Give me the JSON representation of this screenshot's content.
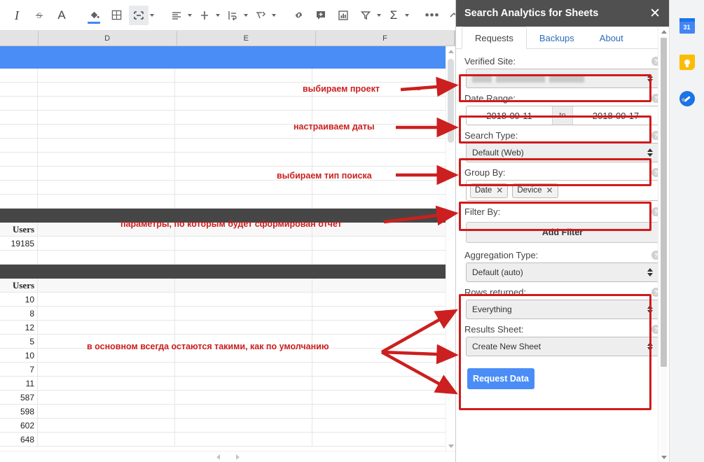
{
  "toolbar": {
    "items": [
      {
        "name": "italic-icon",
        "glyph": "I"
      },
      {
        "name": "strikethrough-icon",
        "glyph": "S"
      },
      {
        "name": "text-color-icon",
        "glyph": "A"
      },
      {
        "name": "fill-color-icon",
        "glyph": "fill"
      },
      {
        "name": "borders-icon",
        "glyph": "grid"
      },
      {
        "name": "merge-cells-icon",
        "glyph": "merge"
      },
      {
        "name": "horizontal-align-icon",
        "glyph": "align"
      },
      {
        "name": "vertical-align-icon",
        "glyph": "valign"
      },
      {
        "name": "text-wrapping-icon",
        "glyph": "wrap"
      },
      {
        "name": "text-rotation-icon",
        "glyph": "rotate"
      },
      {
        "name": "insert-link-icon",
        "glyph": "link"
      },
      {
        "name": "insert-comment-icon",
        "glyph": "comment"
      },
      {
        "name": "insert-chart-icon",
        "glyph": "chart"
      },
      {
        "name": "create-filter-icon",
        "glyph": "filter"
      },
      {
        "name": "functions-icon",
        "glyph": "sigma"
      },
      {
        "name": "more-options-icon",
        "glyph": "dots"
      },
      {
        "name": "collapse-toolbar-icon",
        "glyph": "chevron-up"
      }
    ],
    "more_dots": "•••",
    "italic_label": "I",
    "strike_label": "S",
    "textcolor_label": "A",
    "sigma_label": "Σ"
  },
  "sheet": {
    "columns": [
      "",
      "D",
      "E",
      "F"
    ],
    "rows": [
      {
        "type": "selected",
        "values": [
          "",
          "",
          "",
          ""
        ]
      },
      {
        "type": "blank",
        "values": [
          "",
          "",
          "",
          ""
        ]
      },
      {
        "type": "blank",
        "values": [
          "",
          "",
          "",
          ""
        ]
      },
      {
        "type": "blank",
        "values": [
          "",
          "",
          "",
          ""
        ]
      },
      {
        "type": "blank",
        "values": [
          "",
          "",
          "",
          ""
        ]
      },
      {
        "type": "blank",
        "values": [
          "",
          "",
          "",
          ""
        ]
      },
      {
        "type": "blank",
        "values": [
          "",
          "",
          "",
          ""
        ]
      },
      {
        "type": "blank",
        "values": [
          "",
          "",
          "",
          ""
        ]
      },
      {
        "type": "blank",
        "values": [
          "",
          "",
          "",
          ""
        ]
      },
      {
        "type": "blank",
        "values": [
          "",
          "",
          "",
          ""
        ]
      },
      {
        "type": "blank",
        "values": [
          "",
          "",
          "",
          ""
        ]
      },
      {
        "type": "dark",
        "values": [
          "",
          "",
          "",
          ""
        ]
      },
      {
        "type": "header",
        "values": [
          "Users",
          "",
          "",
          ""
        ]
      },
      {
        "type": "data",
        "values": [
          "19185",
          "",
          "",
          ""
        ]
      },
      {
        "type": "blank",
        "values": [
          "",
          "",
          "",
          ""
        ]
      },
      {
        "type": "dark",
        "values": [
          "",
          "",
          "",
          ""
        ]
      },
      {
        "type": "header",
        "values": [
          "Users",
          "",
          "",
          ""
        ]
      },
      {
        "type": "data",
        "values": [
          "10",
          "",
          "",
          ""
        ]
      },
      {
        "type": "data",
        "values": [
          "8",
          "",
          "",
          ""
        ]
      },
      {
        "type": "data",
        "values": [
          "12",
          "",
          "",
          ""
        ]
      },
      {
        "type": "data",
        "values": [
          "5",
          "",
          "",
          ""
        ]
      },
      {
        "type": "data",
        "values": [
          "10",
          "",
          "",
          ""
        ]
      },
      {
        "type": "data",
        "values": [
          "7",
          "",
          "",
          ""
        ]
      },
      {
        "type": "data",
        "values": [
          "11",
          "",
          "",
          ""
        ]
      },
      {
        "type": "data",
        "values": [
          "587",
          "",
          "",
          ""
        ]
      },
      {
        "type": "data",
        "values": [
          "598",
          "",
          "",
          ""
        ]
      },
      {
        "type": "data",
        "values": [
          "602",
          "",
          "",
          ""
        ]
      },
      {
        "type": "data",
        "values": [
          "648",
          "",
          "",
          ""
        ]
      }
    ]
  },
  "panel": {
    "title": "Search Analytics for Sheets",
    "close_label": "✕",
    "tabs": [
      {
        "label": "Requests",
        "active": true
      },
      {
        "label": "Backups",
        "active": false
      },
      {
        "label": "About",
        "active": false
      }
    ],
    "help_glyph": "?",
    "fields": {
      "verified_site": {
        "label": "Verified Site:",
        "value": ""
      },
      "date_range": {
        "label": "Date Range:",
        "start": "2018-09-11",
        "to": "to",
        "end": "2018-09-17"
      },
      "search_type": {
        "label": "Search Type:",
        "value": "Default (Web)"
      },
      "group_by": {
        "label": "Group By:",
        "chips": [
          "Date",
          "Device"
        ],
        "chip_remove": "✕"
      },
      "filter_by": {
        "label": "Filter By:",
        "button": "Add Filter"
      },
      "aggregation_type": {
        "label": "Aggregation Type:",
        "value": "Default (auto)"
      },
      "rows_returned": {
        "label": "Rows returned:",
        "value": "Everything"
      },
      "results_sheet": {
        "label": "Results Sheet:",
        "value": "Create New Sheet"
      }
    },
    "request_button": "Request Data"
  },
  "rail": {
    "calendar_day": "31",
    "icons": [
      "calendar-icon",
      "keep-icon",
      "tasks-icon"
    ]
  },
  "annotations": {
    "accent_color": "#cc1f1f",
    "labels": [
      {
        "name": "annotation-select-project",
        "text": "выбираем проект"
      },
      {
        "name": "annotation-configure-dates",
        "text": "настраиваем даты"
      },
      {
        "name": "annotation-select-search-type",
        "text": "выбираем тип поиска"
      },
      {
        "name": "annotation-report-parameters",
        "text": "параметры, по которым будет сформирован отчет"
      },
      {
        "name": "annotation-defaults",
        "text": "в основном всегда остаются такими, как по умолчанию"
      }
    ]
  }
}
